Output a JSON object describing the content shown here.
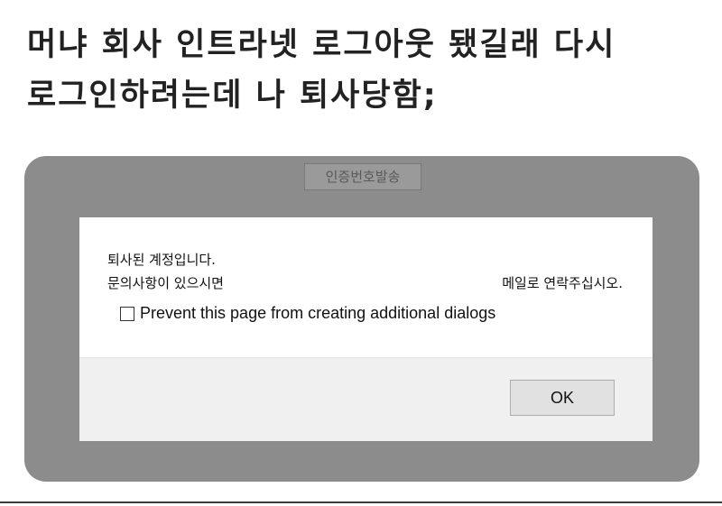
{
  "caption": {
    "line1": "머냐 회사 인트라넷 로그아웃 됐길래 다시",
    "line2": "로그인하려는데 나 퇴사당함;"
  },
  "background": {
    "button_label": "인증번호발송"
  },
  "dialog": {
    "message_line1": "퇴사된 계정입니다.",
    "message_line2_left": "문의사항이 있으시면",
    "message_line2_right": "메일로 연락주십시오.",
    "checkbox_label": "Prevent this page from creating additional dialogs",
    "checkbox_checked": false,
    "ok_label": "OK"
  },
  "colors": {
    "overlay": "#8c8c8c",
    "dialog_body": "#ffffff",
    "dialog_footer": "#f0f0f0"
  }
}
